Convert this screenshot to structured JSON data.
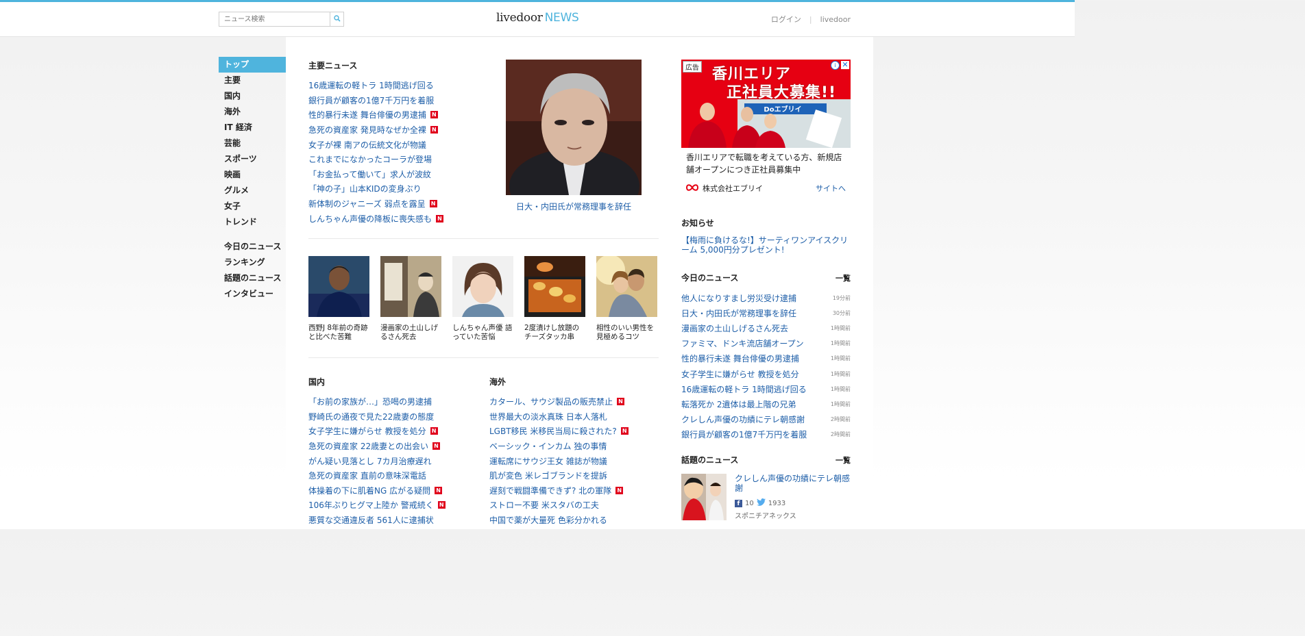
{
  "header": {
    "search_placeholder": "ニュース検索",
    "logo_primary": "livedoor",
    "logo_secondary": "NEWS",
    "login": "ログイン",
    "livedoor_link": "livedoor"
  },
  "sidebar": {
    "items": [
      "トップ",
      "主要",
      "国内",
      "海外",
      "IT 経済",
      "芸能",
      "スポーツ",
      "映画",
      "グルメ",
      "女子",
      "トレンド"
    ],
    "items2": [
      "今日のニュース",
      "ランキング",
      "話題のニュース",
      "インタビュー"
    ]
  },
  "major_news": {
    "title": "主要ニュース",
    "items": [
      {
        "text": "16歳運転の軽トラ 1時間逃げ回る",
        "new": false
      },
      {
        "text": "銀行員が顧客の1億7千万円を着服",
        "new": false
      },
      {
        "text": "性的暴行未遂 舞台俳優の男逮捕",
        "new": true
      },
      {
        "text": "急死の資産家 発見時なぜか全裸",
        "new": true
      },
      {
        "text": "女子が裸 南アの伝統文化が物議",
        "new": false
      },
      {
        "text": "これまでになかったコーラが登場",
        "new": false
      },
      {
        "text": "「お金払って働いて」求人が波紋",
        "new": false
      },
      {
        "text": "「神の子」山本KIDの変身ぶり",
        "new": false
      },
      {
        "text": "新体制のジャニーズ 弱点を露呈",
        "new": true
      },
      {
        "text": "しんちゃん声優の降板に喪失感も",
        "new": true
      }
    ]
  },
  "feature": {
    "caption": "日大・内田氏が常務理事を辞任"
  },
  "photo_news": [
    {
      "title": "西野J 8年前の奇跡と比べた苦難"
    },
    {
      "title": "漫画家の土山しげるさん死去"
    },
    {
      "title": "しんちゃん声優 語っていた苦悩"
    },
    {
      "title": "2度漬けし放題のチーズタッカ串"
    },
    {
      "title": "相性のいい男性を見極めるコツ"
    }
  ],
  "domestic": {
    "title": "国内",
    "items": [
      {
        "text": "「お前の家族が…」恐喝の男逮捕",
        "new": false
      },
      {
        "text": "野崎氏の通夜で見た22歳妻の態度",
        "new": false
      },
      {
        "text": "女子学生に嫌がらせ 教授を処分",
        "new": true
      },
      {
        "text": "急死の資産家 22歳妻との出会い",
        "new": true
      },
      {
        "text": "がん疑い見落とし 7カ月治療遅れ",
        "new": false
      },
      {
        "text": "急死の資産家 直前の意味深電話",
        "new": false
      },
      {
        "text": "体操着の下に肌着NG 広がる疑問",
        "new": true
      },
      {
        "text": "106年ぶりヒグマ上陸か 警戒続く",
        "new": true
      },
      {
        "text": "悪質な交通違反者 561人に逮捕状",
        "new": false
      }
    ]
  },
  "overseas": {
    "title": "海外",
    "items": [
      {
        "text": "カタール、サウジ製品の販売禁止",
        "new": true
      },
      {
        "text": "世界最大の淡水真珠 日本人落札",
        "new": false
      },
      {
        "text": "LGBT移民 米移民当局に殺された?",
        "new": true
      },
      {
        "text": "ベーシック・インカム 独の事情",
        "new": false
      },
      {
        "text": "運転席にサウジ王女 雑誌が物議",
        "new": false
      },
      {
        "text": "肌が変色 米レゴブランドを提訴",
        "new": false
      },
      {
        "text": "遅刻で戦闘準備できず? 北の軍隊",
        "new": true
      },
      {
        "text": "ストロー不要 米スタバの工夫",
        "new": false
      },
      {
        "text": "中国で薬が大量死 色彩分かれる",
        "new": false
      }
    ]
  },
  "ad": {
    "label": "広告",
    "headline1": "香川エリア",
    "headline2": "正社員大募集!!",
    "text": "香川エリアで転職を考えている方、新規店舗オープンにつき正社員募集中",
    "company": "株式会社エブリイ",
    "site_link": "サイトへ",
    "store_sign": "Doエブリイ",
    "brand_color": "#e60012"
  },
  "notice": {
    "title": "お知らせ",
    "text": "【梅雨に負けるな!】サーティワンアイスクリーム 5,000円分プレゼント!"
  },
  "today_news": {
    "title": "今日のニュース",
    "more": "一覧",
    "items": [
      {
        "text": "他人になりすまし労災受け逮捕",
        "time": "19分前"
      },
      {
        "text": "日大・内田氏が常務理事を辞任",
        "time": "30分前"
      },
      {
        "text": "漫画家の土山しげるさん死去",
        "time": "1時間前"
      },
      {
        "text": "ファミマ、ドンキ流店舗オープン",
        "time": "1時間前"
      },
      {
        "text": "性的暴行未遂 舞台俳優の男逮捕",
        "time": "1時間前"
      },
      {
        "text": "女子学生に嫌がらせ 教授を処分",
        "time": "1時間前"
      },
      {
        "text": "16歳運転の軽トラ 1時間逃げ回る",
        "time": "1時間前"
      },
      {
        "text": "転落死か 2遺体は最上階の兄弟",
        "time": "1時間前"
      },
      {
        "text": "クレしん声優の功績にテレ朝感謝",
        "time": "2時間前"
      },
      {
        "text": "銀行員が顧客の1億7千万円を着服",
        "time": "2時間前"
      }
    ]
  },
  "topic_news": {
    "title": "話題のニュース",
    "more": "一覧",
    "item": {
      "title": "クレしん声優の功績にテレ朝感謝",
      "fb_count": "10",
      "tw_count": "1933",
      "source": "スポニチアネックス"
    }
  },
  "colors": {
    "accent": "#4fb4dd",
    "link": "#1d5ea8",
    "new_badge": "#e0001b"
  }
}
